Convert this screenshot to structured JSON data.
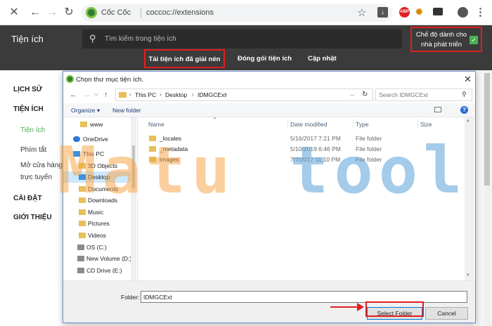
{
  "browser": {
    "brand": "Cốc Cốc",
    "url": "coccoc://extensions",
    "ext_icons": [
      "star-icon",
      "download-icon",
      "adblock-plus-icon",
      "gear-extension-icon",
      "camera-icon",
      "avatar-icon",
      "menu-icon"
    ],
    "abp_label": "ABP"
  },
  "ext_page": {
    "title": "Tiện ích",
    "search_placeholder": "Tìm kiếm trong tiện ích",
    "dev_mode_label": "Chế độ dành cho nhà phát triển",
    "dev_mode_checked": true,
    "tabs": {
      "load_unpacked": "Tải tiện ích đã giải nén",
      "pack": "Đóng gói tiện ích",
      "update": "Cập nhật"
    }
  },
  "left_nav": {
    "history": "LỊCH SỬ",
    "extensions": "TIỆN ÍCH",
    "extensions_sub": "Tiện ích",
    "shortcuts": "Phím tắt",
    "store_line1": "Mở cửa hàng",
    "store_line2": "trực tuyến",
    "settings": "CÀI ĐẶT",
    "about": "GIỚI THIỆU"
  },
  "dialog": {
    "title": "Chọn thư mục tiện ích.",
    "breadcrumb": [
      "This PC",
      "Desktop",
      "IDMGCExt"
    ],
    "search_placeholder": "Search IDMGCExt",
    "toolbar": {
      "organize": "Organize ▾",
      "new_folder": "New folder"
    },
    "tree": [
      {
        "label": "www",
        "icon": "folder-icon",
        "indent": 1,
        "selected": false
      },
      {
        "label": "OneDrive",
        "icon": "cloud-icon",
        "indent": 0,
        "selected": false
      },
      {
        "label": "This PC",
        "icon": "pc-icon",
        "indent": 0,
        "selected": false
      },
      {
        "label": "3D Objects",
        "icon": "folder-icon",
        "indent": 1,
        "selected": false
      },
      {
        "label": "Desktop",
        "icon": "folder-icon",
        "indent": 1,
        "selected": true
      },
      {
        "label": "Documents",
        "icon": "folder-icon",
        "indent": 1,
        "selected": false
      },
      {
        "label": "Downloads",
        "icon": "folder-icon",
        "indent": 1,
        "selected": false
      },
      {
        "label": "Music",
        "icon": "folder-icon",
        "indent": 1,
        "selected": false
      },
      {
        "label": "Pictures",
        "icon": "folder-icon",
        "indent": 1,
        "selected": false
      },
      {
        "label": "Videos",
        "icon": "folder-icon",
        "indent": 1,
        "selected": false
      },
      {
        "label": "OS (C:)",
        "icon": "drive-icon",
        "indent": 1,
        "selected": false
      },
      {
        "label": "New Volume (D:)",
        "icon": "drive-icon",
        "indent": 1,
        "selected": false
      },
      {
        "label": "CD Drive (E:)",
        "icon": "cd-drive-icon",
        "indent": 1,
        "selected": false
      }
    ],
    "columns": {
      "name": "Name",
      "date": "Date modified",
      "type": "Type",
      "size": "Size"
    },
    "files": [
      {
        "name": "_locales",
        "date": "5/16/2017 7:21 PM",
        "type": "File folder",
        "size": ""
      },
      {
        "name": "_metadata",
        "date": "5/10/2019 6:46 PM",
        "type": "File folder",
        "size": ""
      },
      {
        "name": "images",
        "date": "7/7/2017 11:10 PM",
        "type": "File folder",
        "size": ""
      }
    ],
    "folder_label": "Folder:",
    "folder_value": "IDMGCExt",
    "select_button": "Select Folder",
    "cancel_button": "Cancel"
  },
  "watermark": {
    "part1": "Matu",
    "part2": "tool"
  },
  "colors": {
    "header_bg": "#3b3b3b",
    "accent_green": "#4caf50",
    "highlight_red": "#e02020",
    "selection_blue": "#cce8ff"
  }
}
